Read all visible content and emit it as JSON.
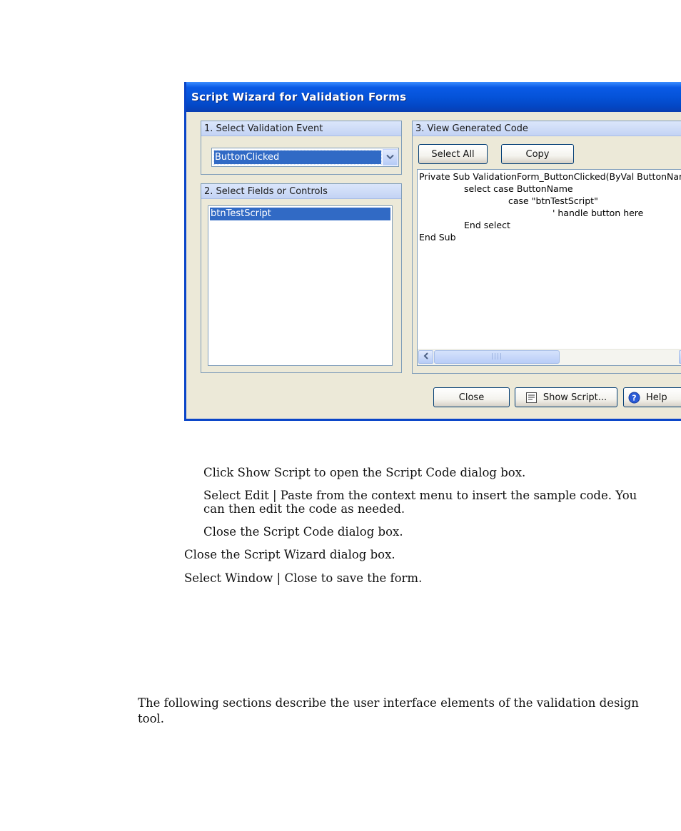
{
  "dialog": {
    "title": "Script Wizard for Validation Forms",
    "event_group": {
      "heading": "1. Select Validation Event",
      "selected_event": "ButtonClicked"
    },
    "fields_group": {
      "heading": "2. Select Fields or Controls",
      "items": [
        "btnTestScript"
      ]
    },
    "code_group": {
      "heading": "3. View Generated Code",
      "select_all_label": "Select All",
      "copy_label": "Copy",
      "lines": [
        "Private Sub ValidationForm_ButtonClicked(ByVal ButtonName",
        "select case ButtonName",
        "case \"btnTestScript\"",
        "' handle button here",
        "End select",
        "End Sub"
      ]
    },
    "footer": {
      "close_label": "Close",
      "show_script_label": "Show Script...",
      "help_label": "Help"
    }
  },
  "steps": [
    "Click Show Script to open the Script Code dialog box.",
    "Select Edit | Paste from the context menu to insert the sample code. You",
    "can then edit the code as needed.",
    "Close the Script Code dialog box.",
    "Close the Script Wizard dialog box.",
    "Select Window | Close to save the form."
  ],
  "description": {
    "line1": "The following sections describe the user interface elements of the validation design",
    "line2": "tool."
  }
}
